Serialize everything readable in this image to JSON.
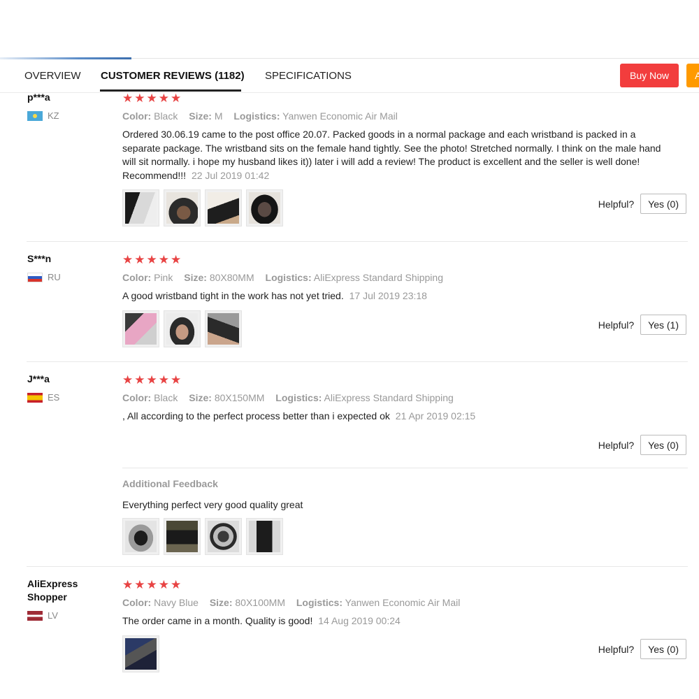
{
  "tabs": {
    "overview": "OVERVIEW",
    "reviews": "CUSTOMER REVIEWS (1182)",
    "specifications": "SPECIFICATIONS"
  },
  "actions": {
    "buy_now": "Buy Now",
    "add_partial": "A"
  },
  "labels": {
    "color": "Color:",
    "size": "Size:",
    "logistics": "Logistics:",
    "helpful": "Helpful?",
    "additional_feedback": "Additional Feedback"
  },
  "colors": {
    "star": "#e84343",
    "buy_now_bg": "#f23d3d",
    "add_bg": "#ff9a00"
  },
  "reviews": [
    {
      "user": "p***a",
      "country": "KZ",
      "flag": "kz-flag-icon",
      "rating": 5,
      "color": "Black",
      "size": "M",
      "logistics": "Yanwen Economic Air Mail",
      "text": "Ordered 30.06.19 came to the post office 20.07. Packed goods in a normal package and each wristband is packed in a separate package. The wristband sits on the female hand tightly. See the photo! Stretched normally. I think on the male hand will sit normally. i hope my husband likes it)) later i will add a review! The product is excellent and the seller is well done! Recommend!!!",
      "date": "22 Jul 2019 01:42",
      "photos": 4,
      "helpful": "Yes (0)"
    },
    {
      "user": "S***n",
      "country": "RU",
      "flag": "ru-flag-icon",
      "rating": 5,
      "color": "Pink",
      "size": "80X80MM",
      "logistics": "AliExpress Standard Shipping",
      "text": "A good wristband tight in the work has not yet tried.",
      "date": "17 Jul 2019 23:18",
      "photos": 3,
      "helpful": "Yes (1)"
    },
    {
      "user": "J***a",
      "country": "ES",
      "flag": "es-flag-icon",
      "rating": 5,
      "color": "Black",
      "size": "80X150MM",
      "logistics": "AliExpress Standard Shipping",
      "text": ", All according to the perfect process better than i expected ok",
      "date": "21 Apr 2019 02:15",
      "photos": 0,
      "helpful": "Yes (0)",
      "additional": {
        "text": "Everything perfect very good quality great",
        "photos": 4
      }
    },
    {
      "user": "AliExpress Shopper",
      "country": "LV",
      "flag": "lv-flag-icon",
      "rating": 5,
      "color": "Navy Blue",
      "size": "80X100MM",
      "logistics": "Yanwen Economic Air Mail",
      "text": "The order came in a month. Quality is good!",
      "date": "14 Aug 2019 00:24",
      "photos": 1,
      "helpful": "Yes (0)"
    }
  ]
}
